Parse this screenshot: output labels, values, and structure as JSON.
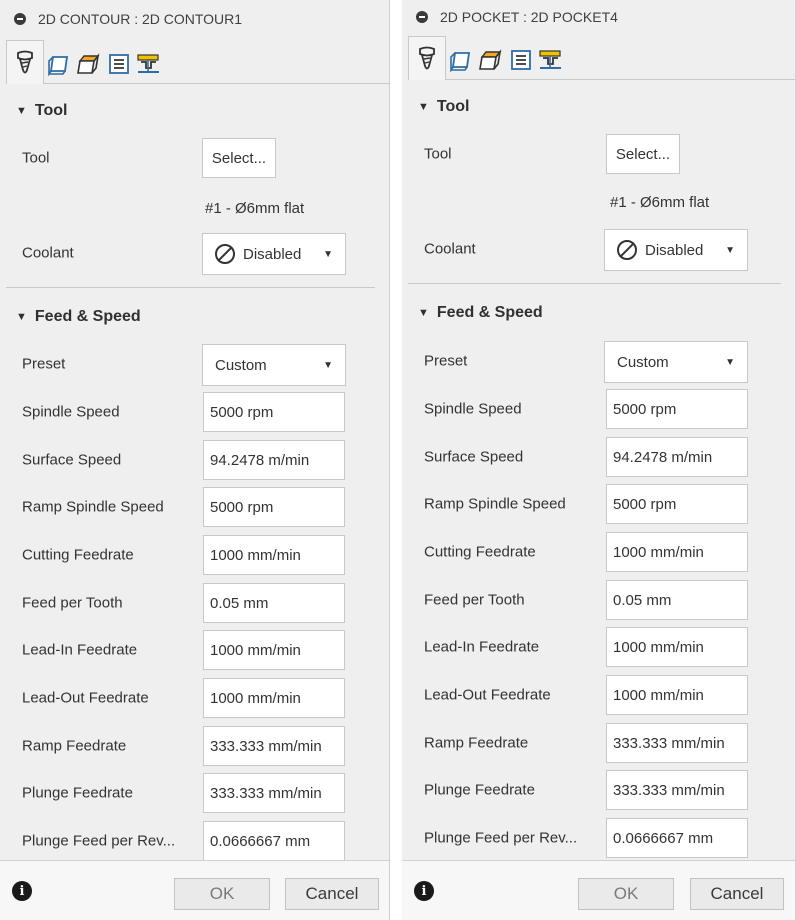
{
  "left": {
    "title": "2D CONTOUR : 2D CONTOUR1",
    "tool_section": "Tool",
    "tool_label": "Tool",
    "tool_button": "Select...",
    "tool_name": "#1 - Ø6mm flat",
    "coolant_label": "Coolant",
    "coolant_value": "Disabled",
    "feed_section": "Feed & Speed",
    "preset_label": "Preset",
    "preset_value": "Custom",
    "fields": [
      {
        "label": "Spindle Speed",
        "value": "5000 rpm"
      },
      {
        "label": "Surface Speed",
        "value": "94.2478 m/min"
      },
      {
        "label": "Ramp Spindle Speed",
        "value": "5000 rpm"
      },
      {
        "label": "Cutting Feedrate",
        "value": "1000 mm/min"
      },
      {
        "label": "Feed per Tooth",
        "value": "0.05 mm"
      },
      {
        "label": "Lead-In Feedrate",
        "value": "1000 mm/min"
      },
      {
        "label": "Lead-Out Feedrate",
        "value": "1000 mm/min"
      },
      {
        "label": "Ramp Feedrate",
        "value": "333.333 mm/min"
      },
      {
        "label": "Plunge Feedrate",
        "value": "333.333 mm/min"
      },
      {
        "label": "Plunge Feed per Rev...",
        "value": "0.0666667 mm"
      }
    ],
    "ok_label": "OK",
    "cancel_label": "Cancel"
  },
  "right": {
    "title": "2D POCKET : 2D POCKET4",
    "tool_section": "Tool",
    "tool_label": "Tool",
    "tool_button": "Select...",
    "tool_name": "#1 - Ø6mm flat",
    "coolant_label": "Coolant",
    "coolant_value": "Disabled",
    "feed_section": "Feed & Speed",
    "preset_label": "Preset",
    "preset_value": "Custom",
    "fields": [
      {
        "label": "Spindle Speed",
        "value": "5000 rpm"
      },
      {
        "label": "Surface Speed",
        "value": "94.2478 m/min"
      },
      {
        "label": "Ramp Spindle Speed",
        "value": "5000 rpm"
      },
      {
        "label": "Cutting Feedrate",
        "value": "1000 mm/min"
      },
      {
        "label": "Feed per Tooth",
        "value": "0.05 mm"
      },
      {
        "label": "Lead-In Feedrate",
        "value": "1000 mm/min"
      },
      {
        "label": "Lead-Out Feedrate",
        "value": "1000 mm/min"
      },
      {
        "label": "Ramp Feedrate",
        "value": "333.333 mm/min"
      },
      {
        "label": "Plunge Feedrate",
        "value": "333.333 mm/min"
      },
      {
        "label": "Plunge Feed per Rev...",
        "value": "0.0666667 mm"
      }
    ],
    "ok_label": "OK",
    "cancel_label": "Cancel"
  },
  "tab_icons": [
    "tool-tab-icon",
    "geometry-tab-icon",
    "heights-tab-icon",
    "passes-tab-icon",
    "linking-tab-icon"
  ],
  "colors": {
    "panel_bg": "#efefef",
    "field_border": "#c8c8c8",
    "tab_orange": "#f5a623",
    "tab_blue": "#2e6da4",
    "tab_yellow": "#f2c200"
  }
}
